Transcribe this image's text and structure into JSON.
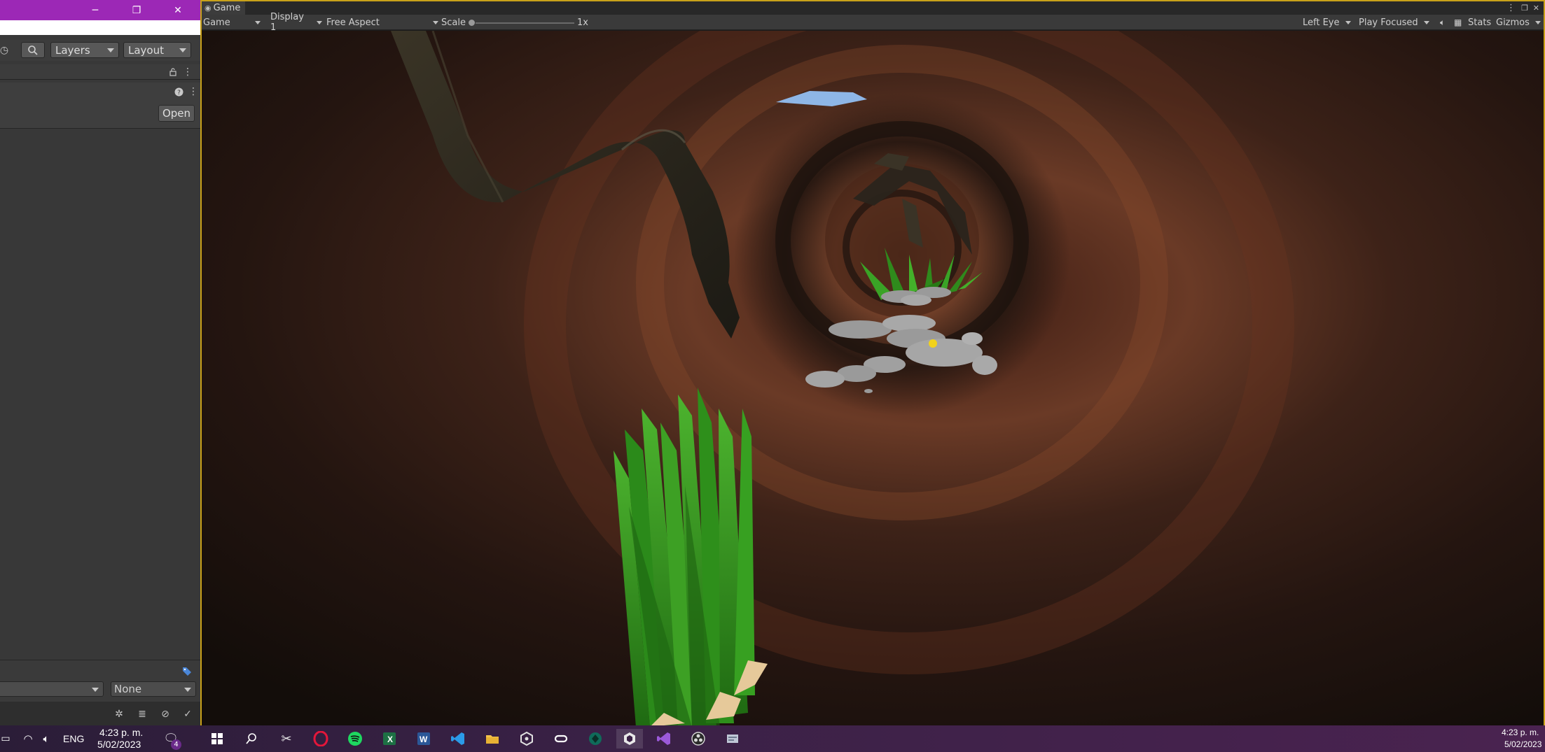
{
  "left_panel": {
    "window_controls": {
      "minimize": "─",
      "restore": "❐",
      "close": "✕"
    },
    "toolbar": {
      "layers_label": "Layers",
      "layout_label": "Layout"
    },
    "inspector": {
      "open_label": "Open"
    },
    "bottom": {
      "none_label": "None"
    }
  },
  "game_view": {
    "tab_label": "Game",
    "toolbar": {
      "view_mode": "Game",
      "display": "Display 1",
      "aspect": "Free Aspect",
      "scale_label": "Scale",
      "scale_value": "1x",
      "eye": "Left Eye",
      "play_mode": "Play Focused",
      "stats": "Stats",
      "gizmos": "Gizmos"
    }
  },
  "taskbar": {
    "language": "ENG",
    "left_time": "4:23 p. m.",
    "left_date": "5/02/2023",
    "notification_count": "4",
    "right_time": "4:23 p. m.",
    "right_date": "5/02/2023",
    "apps": [
      "windows-start",
      "search",
      "snip",
      "opera",
      "spotify",
      "excel",
      "word",
      "vscode",
      "file-explorer",
      "unity-hub",
      "oculus",
      "gamemaker",
      "unity",
      "visual-studio",
      "obs",
      "file-manager"
    ]
  },
  "colors": {
    "title_bar_purple": "#9c28b6",
    "game_border_gold": "#c9a21a",
    "grass_green": "#2f8a1c",
    "rock_grey": "#9a9a9a",
    "sky_blue": "#8eb6e6"
  }
}
